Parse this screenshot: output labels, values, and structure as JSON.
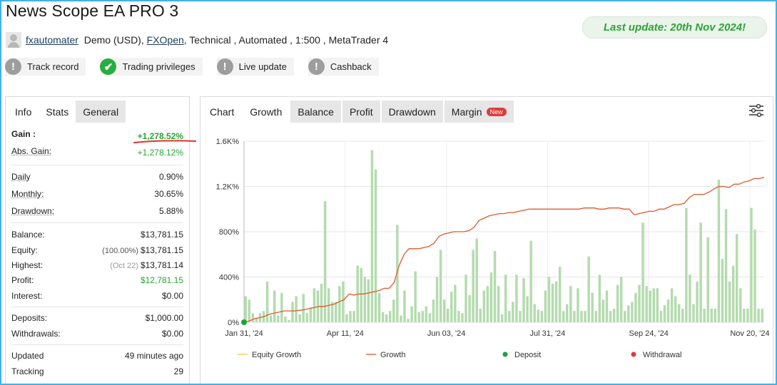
{
  "header": {
    "title": "News Scope EA PRO 3",
    "user": "fxautomater",
    "account_type": "Demo (USD),",
    "broker": "FXOpen",
    "details": ", Technical , Automated , 1:500 , MetaTrader 4",
    "last_update": "Last update: 20th Nov 2024!"
  },
  "badges": [
    {
      "label": "Track record",
      "status": "grey",
      "icon": "exclamation-icon"
    },
    {
      "label": "Trading privileges",
      "status": "green",
      "icon": "check-icon"
    },
    {
      "label": "Live update",
      "status": "grey",
      "icon": "exclamation-icon"
    },
    {
      "label": "Cashback",
      "status": "grey",
      "icon": "exclamation-icon"
    }
  ],
  "left_tabs": [
    "Info",
    "Stats",
    "General"
  ],
  "stats": {
    "gain_label": "Gain :",
    "gain_value": "+1,278.52%",
    "abs_gain_label": "Abs. Gain:",
    "abs_gain_value": "+1,278.12%",
    "daily_label": "Daily",
    "daily_value": "0.90%",
    "monthly_label": "Monthly:",
    "monthly_value": "30.65%",
    "drawdown_label": "Drawdown:",
    "drawdown_value": "5.88%",
    "balance_label": "Balance:",
    "balance_value": "$13,781.15",
    "equity_label": "Equity:",
    "equity_pct": "(100.00%)",
    "equity_value": "$13,781.15",
    "highest_label": "Highest:",
    "highest_date": "(Oct 22)",
    "highest_value": "$13,781.14",
    "profit_label": "Profit:",
    "profit_value": "$12,781.15",
    "interest_label": "Interest:",
    "interest_value": "$0.00",
    "deposits_label": "Deposits:",
    "deposits_value": "$1,000.00",
    "withdrawals_label": "Withdrawals:",
    "withdrawals_value": "$0.00",
    "updated_label": "Updated",
    "updated_value": "49 minutes ago",
    "tracking_label": "Tracking",
    "tracking_value": "29"
  },
  "chart_tabs": [
    "Chart",
    "Growth",
    "Balance",
    "Profit",
    "Drawdown",
    "Margin"
  ],
  "chart_new_tag": "New",
  "colors": {
    "accent": "#3fb3ea",
    "positive": "#26a532",
    "growth_line": "#e2582e",
    "bars": "#b4dbae",
    "deposit": "#1aa336",
    "withdrawal": "#e03a3a",
    "equity_growth": "#f2c94c"
  },
  "chart_data": {
    "type": "line",
    "ylim": [
      0,
      1600
    ],
    "yticks": [
      "0%",
      "400%",
      "800%",
      "1.2K%",
      "1.6K%"
    ],
    "yticks_values": [
      0,
      400,
      800,
      1200,
      1600
    ],
    "xticks": [
      "Jan 31, '24",
      "Apr 11, '24",
      "Jun 03, '24",
      "Jul 31, '24",
      "Sep 24, '24",
      "Nov 20, '24"
    ],
    "legend": [
      "Equity Growth",
      "Growth",
      "Deposit",
      "Withdrawal"
    ],
    "growth": [
      0,
      10,
      30,
      40,
      50,
      70,
      80,
      90,
      100,
      100,
      100,
      105,
      110,
      120,
      130,
      140,
      140,
      150,
      160,
      180,
      200,
      250,
      240,
      250,
      250,
      260,
      270,
      280,
      300,
      300,
      350,
      500,
      600,
      650,
      650,
      650,
      660,
      670,
      700,
      760,
      780,
      790,
      800,
      800,
      800,
      810,
      840,
      900,
      920,
      940,
      950,
      960,
      960,
      970,
      970,
      980,
      990,
      1000,
      1000,
      1000,
      1000,
      1000,
      1000,
      1000,
      1000,
      1000,
      1000,
      1000,
      1010,
      1010,
      1010,
      1000,
      1000,
      1010,
      1010,
      1010,
      1000,
      1000,
      950,
      960,
      970,
      980,
      980,
      1000,
      1000,
      1020,
      1040,
      1040,
      1050,
      1100,
      1130,
      1130,
      1130,
      1150,
      1180,
      1200,
      1200,
      1190,
      1220,
      1220,
      1240,
      1250,
      1270,
      1270,
      1280
    ],
    "deposit": [
      {
        "index": 0,
        "value": 0
      }
    ],
    "bars": [
      230,
      200,
      80,
      40,
      80,
      100,
      360,
      60,
      280,
      60,
      260,
      50,
      20,
      180,
      230,
      70,
      250,
      80,
      130,
      300,
      280,
      340,
      1070,
      300,
      180,
      180,
      320,
      360,
      70,
      100,
      100,
      500,
      480,
      400,
      380,
      1520,
      1350,
      260,
      90,
      70,
      100,
      200,
      860,
      60,
      280,
      30,
      140,
      450,
      90,
      100,
      140,
      80,
      200,
      400,
      640,
      200,
      120,
      270,
      330,
      100,
      80,
      420,
      240,
      640,
      740,
      120,
      280,
      320,
      440,
      630,
      320,
      70,
      420,
      100,
      180,
      420,
      100,
      390,
      230,
      720,
      160,
      110,
      100,
      280,
      400,
      340,
      360,
      490,
      100,
      160,
      320,
      100,
      300,
      100,
      100,
      580,
      260,
      100,
      420,
      200,
      280,
      100,
      120,
      330,
      400,
      100,
      150,
      180,
      260,
      330,
      880,
      320,
      280,
      300,
      300,
      100,
      150,
      200,
      300,
      230,
      160,
      120,
      1010,
      420,
      160,
      360,
      880,
      120,
      750,
      120,
      120,
      1260,
      560,
      1000,
      360,
      500,
      780,
      300,
      120,
      120,
      1010,
      820,
      120,
      120
    ]
  }
}
